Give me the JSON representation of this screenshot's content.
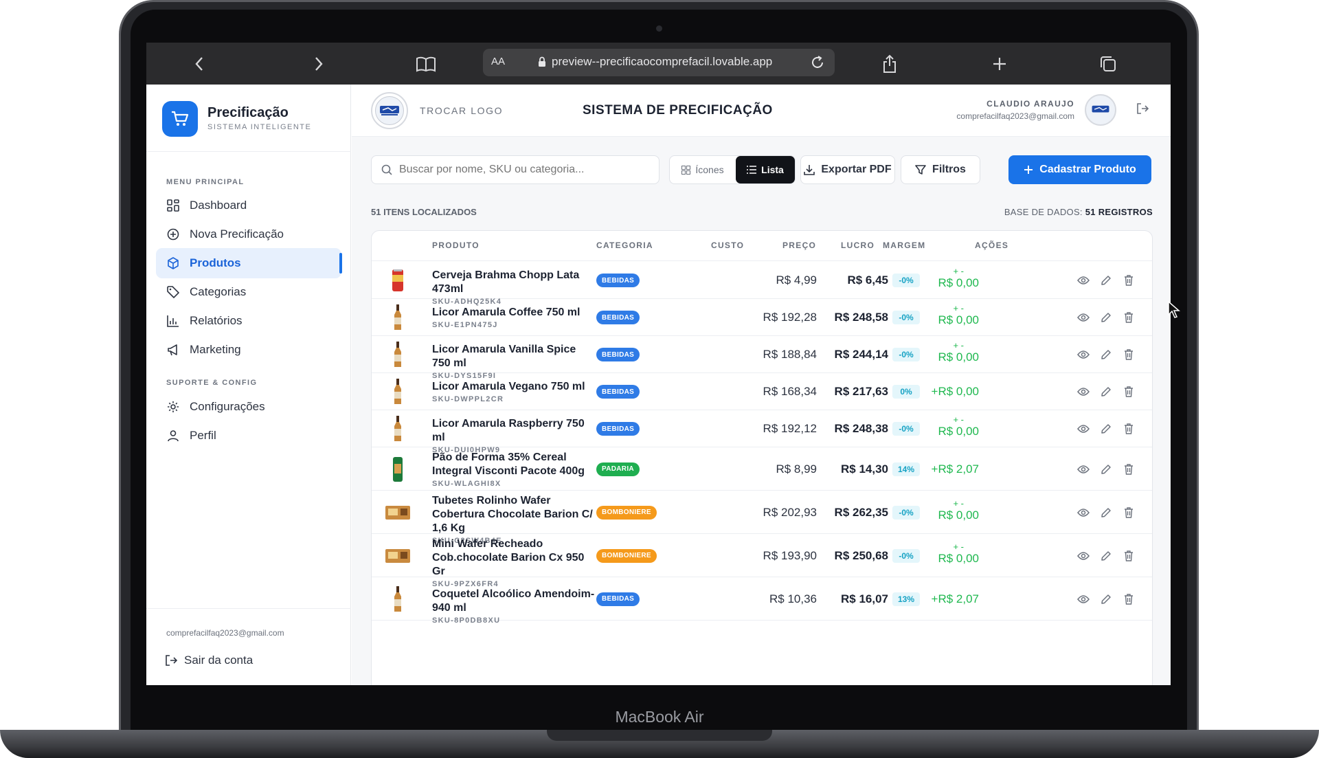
{
  "device": {
    "model_label": "MacBook Air"
  },
  "browser": {
    "text_size_label": "AA",
    "url": "preview--precificaocomprefacil.lovable.app"
  },
  "sidebar": {
    "brand_title": "Precificação",
    "brand_subtitle": "SISTEMA INTELIGENTE",
    "section_main": "MENU PRINCIPAL",
    "items": [
      {
        "label": "Dashboard",
        "icon": "grid-icon"
      },
      {
        "label": "Nova Precificação",
        "icon": "plus-circle-icon"
      },
      {
        "label": "Produtos",
        "icon": "box-icon",
        "active": true
      },
      {
        "label": "Categorias",
        "icon": "tag-icon"
      },
      {
        "label": "Relatórios",
        "icon": "bar-chart-icon"
      },
      {
        "label": "Marketing",
        "icon": "megaphone-icon"
      }
    ],
    "section_support": "SUPORTE & CONFIG",
    "support_items": [
      {
        "label": "Configurações",
        "icon": "gear-icon"
      },
      {
        "label": "Perfil",
        "icon": "user-icon"
      }
    ],
    "footer_email": "comprefacilfaq2023@gmail.com",
    "logout_label": "Sair da conta"
  },
  "header": {
    "change_logo": "TROCAR LOGO",
    "title": "SISTEMA DE PRECIFICAÇÃO",
    "user_name": "CLAUDIO ARAUJO",
    "user_email": "comprefacilfaq2023@gmail.com"
  },
  "toolbar": {
    "search_placeholder": "Buscar por nome, SKU ou categoria...",
    "view_icons": "Ícones",
    "view_list": "Lista",
    "export_pdf": "Exportar PDF",
    "filters": "Filtros",
    "add_product": "Cadastrar Produto"
  },
  "summary": {
    "items_found": "51 ITENS LOCALIZADOS",
    "db_label": "BASE DE DADOS:",
    "db_count": "51 REGISTROS"
  },
  "table": {
    "headers": {
      "produto": "PRODUTO",
      "categoria": "CATEGORIA",
      "custo": "CUSTO",
      "preco": "PREÇO",
      "lucro": "LUCRO",
      "margem": "MARGEM",
      "acoes": "AÇÕES"
    },
    "rows": [
      {
        "name": "Cerveja Brahma Chopp Lata 473ml",
        "sku": "SKU-ADHQ25K4",
        "category": "BEBIDAS",
        "cost": "R$ 4,99",
        "price": "R$ 6,45",
        "profit_top": "+ -",
        "profit": "R$ 0,00",
        "margin": "-0%",
        "thumb": "can-icon"
      },
      {
        "name": "Licor Amarula Coffee 750 ml",
        "sku": "SKU-E1PN475J",
        "category": "BEBIDAS",
        "cost": "R$ 192,28",
        "price": "R$ 248,58",
        "profit_top": "+ -",
        "profit": "R$ 0,00",
        "margin": "-0%",
        "thumb": "bottle-icon"
      },
      {
        "name": "Licor Amarula Vanilla Spice 750 ml",
        "sku": "SKU-DYS15F9I",
        "category": "BEBIDAS",
        "cost": "R$ 188,84",
        "price": "R$ 244,14",
        "profit_top": "+ -",
        "profit": "R$ 0,00",
        "margin": "-0%",
        "thumb": "bottle-icon"
      },
      {
        "name": "Licor Amarula Vegano 750 ml",
        "sku": "SKU-DWPPL2CR",
        "category": "BEBIDAS",
        "cost": "R$ 168,34",
        "price": "R$ 217,63",
        "profit_top": "",
        "profit": "+R$ 0,00",
        "margin": "0%",
        "thumb": "bottle-icon"
      },
      {
        "name": "Licor Amarula Raspberry 750 ml",
        "sku": "SKU-DUI0HPW9",
        "category": "BEBIDAS",
        "cost": "R$ 192,12",
        "price": "R$ 248,38",
        "profit_top": "+ -",
        "profit": "R$ 0,00",
        "margin": "-0%",
        "thumb": "bottle-icon"
      },
      {
        "name": "Pão de Forma 35% Cereal Integral Visconti Pacote 400g",
        "sku": "SKU-WLAGHI8X",
        "category": "PADARIA",
        "cost": "R$ 8,99",
        "price": "R$ 14,30",
        "profit_top": "",
        "profit": "+R$ 2,07",
        "margin": "14%",
        "thumb": "bread-icon"
      },
      {
        "name": "Tubetes Rolinho Wafer Cobertura Chocolate Barion C/ 1,6 Kg",
        "sku": "SKU-C2SW4B4E",
        "category": "BOMBONIERE",
        "cost": "R$ 202,93",
        "price": "R$ 262,35",
        "profit_top": "+ -",
        "profit": "R$ 0,00",
        "margin": "-0%",
        "thumb": "box-product-icon"
      },
      {
        "name": "Mini Wafer Recheado Cob.chocolate Barion Cx 950 Gr",
        "sku": "SKU-9PZX6FR4",
        "category": "BOMBONIERE",
        "cost": "R$ 193,90",
        "price": "R$ 250,68",
        "profit_top": "+ -",
        "profit": "R$ 0,00",
        "margin": "-0%",
        "thumb": "box-product-icon"
      },
      {
        "name": "Coquetel Alcoólico Amendoim-940 ml",
        "sku": "SKU-8P0DB8XU",
        "category": "BEBIDAS",
        "cost": "R$ 10,36",
        "price": "R$ 16,07",
        "profit_top": "",
        "profit": "+R$ 2,07",
        "margin": "13%",
        "thumb": "bottle-icon"
      }
    ]
  },
  "colors": {
    "accent": "#1a73e8",
    "bebidas": "#2f7be6",
    "padaria": "#1fae50",
    "bomboniere": "#f59a1b",
    "profit": "#1fb84f",
    "margin": "#16a2c4"
  }
}
